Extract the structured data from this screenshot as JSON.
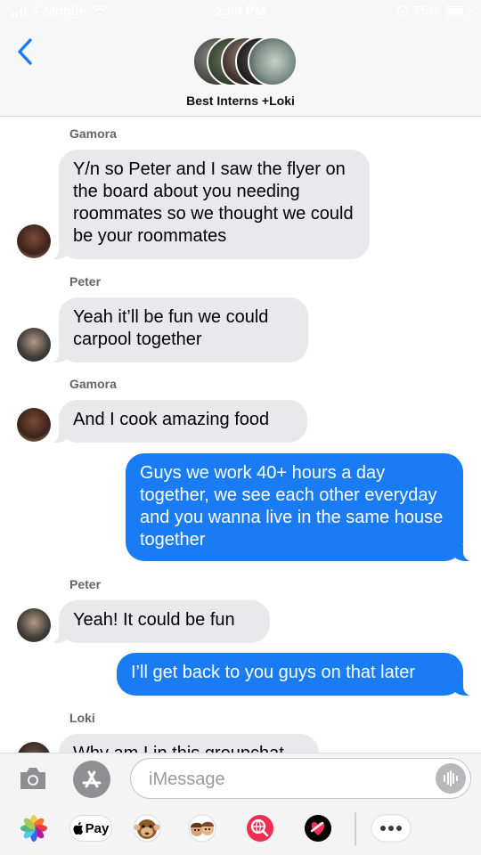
{
  "status_bar": {
    "carrier": "T-Mobile",
    "time": "2:09 PM",
    "battery": "75%"
  },
  "header": {
    "group_name": "Best Interns +Loki",
    "back_icon": "chevron-left-icon"
  },
  "messages": [
    {
      "sender": "Gamora",
      "direction": "in",
      "text": "Y/n so Peter and I saw the flyer on the board about you needing roommates so we thought we could be your roommates"
    },
    {
      "sender": "Peter",
      "direction": "in",
      "text": "Yeah it’ll be fun we could carpool together"
    },
    {
      "sender": "Gamora",
      "direction": "in",
      "text": "And I cook amazing food"
    },
    {
      "sender": "",
      "direction": "out",
      "text": "Guys we work 40+ hours a day together, we see each other everyday and you wanna live in the same house together"
    },
    {
      "sender": "Peter",
      "direction": "in",
      "text": "Yeah! It could be fun"
    },
    {
      "sender": "",
      "direction": "out",
      "text": "I’ll get back to you guys on that later"
    },
    {
      "sender": "Loki",
      "direction": "in",
      "text": "Why am I in this groupchat"
    }
  ],
  "input_bar": {
    "placeholder": "iMessage"
  },
  "app_drawer": {
    "apps": [
      "photos-app-icon",
      "apple-pay-icon",
      "animoji-icon",
      "memoji-icon",
      "web-images-icon",
      "digital-touch-icon",
      "more-apps-icon"
    ],
    "apple_pay_label": "Pay"
  },
  "colors": {
    "outgoing_bubble": "#1a7cf5",
    "incoming_bubble": "#e9e9eb",
    "header_bg": "#f7f7f8"
  }
}
